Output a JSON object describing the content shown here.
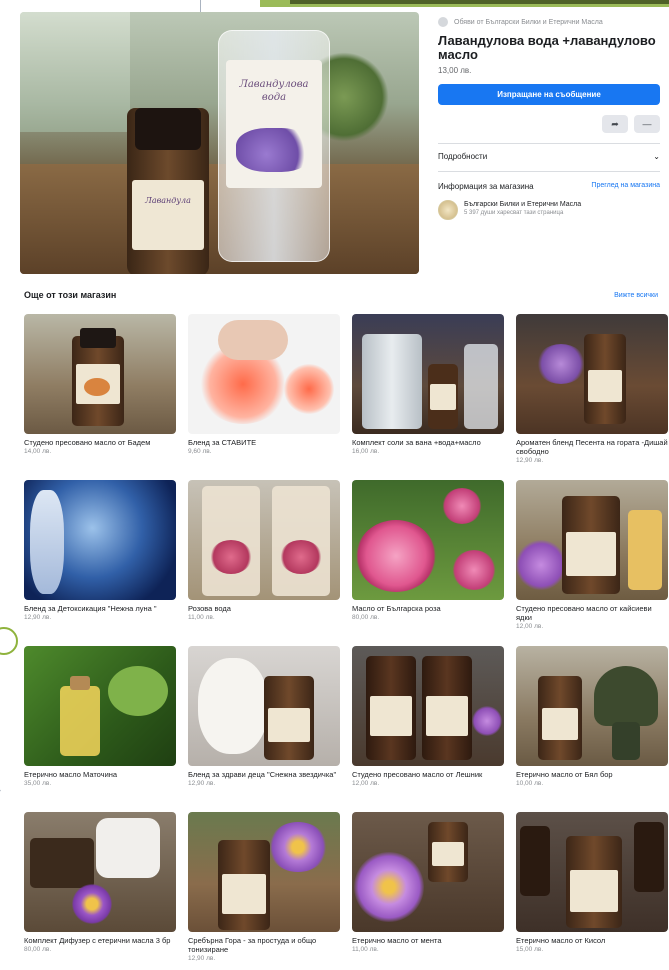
{
  "product": {
    "crumb": "Обяви от Български Билки и Етерични Масла",
    "title": "Лавандулова вода +лавандулово масло",
    "price": "13,00 лв.",
    "message_button": "Изпращане на съобщение",
    "share_icon": "share-icon",
    "more_icon": "more-icon",
    "details_label": "Подробности",
    "seller_info_label": "Информация за магазина",
    "store_link": "Преглед на магазина",
    "seller_name": "Български Билки и Етерични Масла",
    "seller_sub": "5 397 души харесват тази страница",
    "photo_label_spray": "Лавандулова вода",
    "photo_label_bottle": "Лавандула"
  },
  "more": {
    "heading": "Още от този магазин",
    "see_all": "Вижте всички",
    "items": [
      {
        "title": "Студено пресовано масло от Бадем",
        "price": "14,00 лв."
      },
      {
        "title": "Бленд за СТАВИТЕ",
        "price": "9,60 лв."
      },
      {
        "title": "Комплект соли за вана +вода+масло",
        "price": "16,00 лв."
      },
      {
        "title": "Ароматен бленд Песента на гората -Дишай свободно",
        "price": "12,90 лв."
      },
      {
        "title": "Бленд за Детоксикация \"Нежна луна \"",
        "price": "12,90 лв."
      },
      {
        "title": "Розова вода",
        "price": "11,00 лв."
      },
      {
        "title": "Масло от Българска роза",
        "price": "80,00 лв."
      },
      {
        "title": "Студено пресовано масло от кайсиеви ядки",
        "price": "12,00 лв."
      },
      {
        "title": "Етерично масло Маточина",
        "price": "35,00 лв."
      },
      {
        "title": "Бленд за здрави деца \"Снежна звездичка\"",
        "price": "12,90 лв."
      },
      {
        "title": "Студено пресовано масло от Лешник",
        "price": "12,00 лв."
      },
      {
        "title": "Етерично масло от Бял бор",
        "price": "10,00 лв."
      },
      {
        "title": "Комплект Дифузер с етерични масла 3 бр",
        "price": "80,00 лв."
      },
      {
        "title": "Сребърна Гора - за простуда и общо тонизиране",
        "price": "12,90 лв."
      },
      {
        "title": "Етерично масло от мента",
        "price": "11,00 лв."
      },
      {
        "title": "Етерично масло от Кисол",
        "price": "15,00 лв."
      }
    ]
  },
  "colors": {
    "accent": "#1877f2",
    "slide_green": "#9bbb59",
    "slide_dark_green": "#4f6228"
  }
}
